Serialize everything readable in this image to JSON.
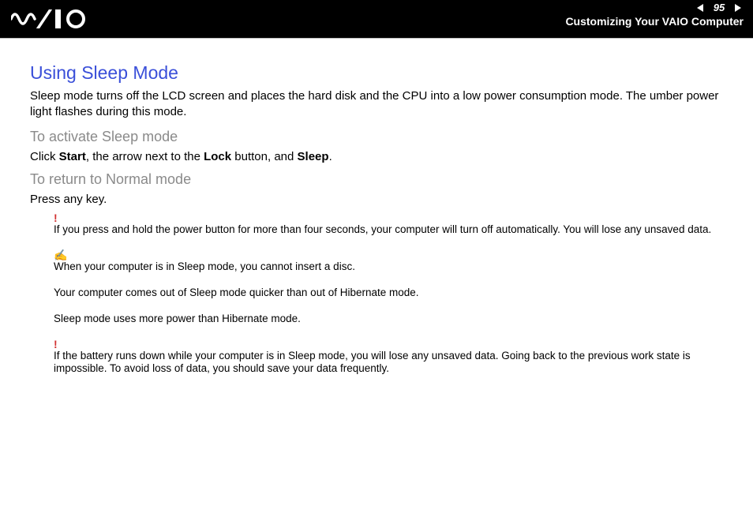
{
  "header": {
    "page_number": "95",
    "section_label": "Customizing Your VAIO Computer"
  },
  "title": "Using Sleep Mode",
  "intro": "Sleep mode turns off the LCD screen and places the hard disk and the CPU into a low power consumption mode. The umber power light flashes during this mode.",
  "sub1": "To activate Sleep mode",
  "sub1_instr_parts": {
    "p0": "Click ",
    "b0": "Start",
    "p1": ", the arrow next to the ",
    "b1": "Lock",
    "p2": " button, and ",
    "b2": "Sleep",
    "p3": "."
  },
  "sub2": "To return to Normal mode",
  "sub2_instr": "Press any key.",
  "notes": {
    "n1": "If you press and hold the power button for more than four seconds, your computer will turn off automatically. You will lose any unsaved data.",
    "n2": "When your computer is in Sleep mode, you cannot insert a disc.",
    "n3": "Your computer comes out of Sleep mode quicker than out of Hibernate mode.",
    "n4": "Sleep mode uses more power than Hibernate mode.",
    "n5": "If the battery runs down while your computer is in Sleep mode, you will lose any unsaved data. Going back to the previous work state is impossible. To avoid loss of data, you should save your data frequently."
  },
  "markers": {
    "warn": "!",
    "tip": "✍"
  }
}
